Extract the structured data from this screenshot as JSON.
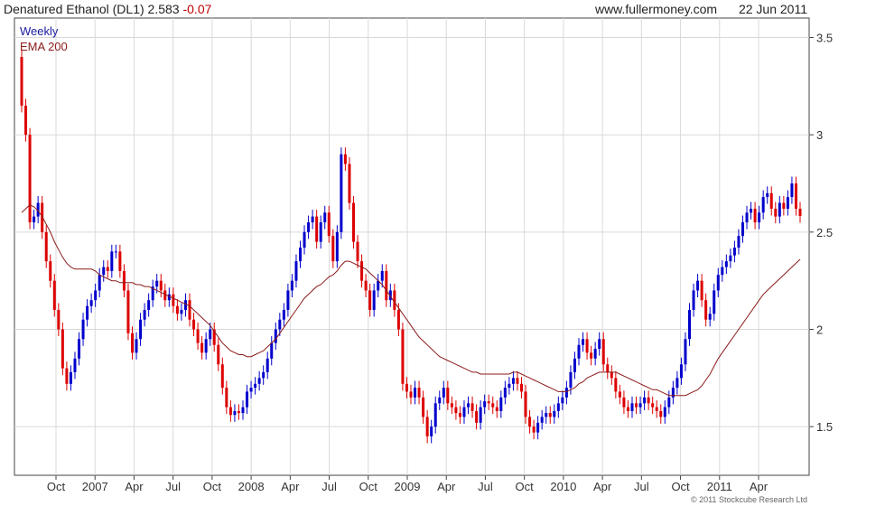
{
  "header": {
    "instrument": "Denatured Ethanol (DL1)",
    "price": "2.583",
    "change": "-0.07",
    "site": "www.fullermoney.com",
    "date": "22 Jun 2011"
  },
  "footer": {
    "copyright": "© 2011 Stockcube Research Ltd"
  },
  "colors": {
    "up": "#0000cc",
    "down": "#dd0000",
    "ema": "#8b1a1a",
    "grid": "#d9d9d9",
    "axis": "#444444"
  },
  "chart_data": {
    "type": "line",
    "legend": [
      "Weekly",
      "EMA 200"
    ],
    "legend_position": "top-left",
    "y_axis_position": "right",
    "ylim": [
      1.25,
      3.6
    ],
    "yticks": [
      1.5,
      2,
      2.5,
      3,
      3.5
    ],
    "x_labels": [
      "Oct",
      "2007",
      "Apr",
      "Jul",
      "Oct",
      "2008",
      "Apr",
      "Jul",
      "Oct",
      "2009",
      "Apr",
      "Jul",
      "Oct",
      "2010",
      "Apr",
      "Jul",
      "Oct",
      "2011",
      "Apr"
    ],
    "grid": true,
    "weekly_close": [
      3.15,
      3.0,
      2.55,
      2.58,
      2.65,
      2.5,
      2.35,
      2.25,
      2.1,
      2.0,
      1.8,
      1.72,
      1.78,
      1.85,
      1.95,
      2.05,
      2.12,
      2.15,
      2.2,
      2.28,
      2.32,
      2.3,
      2.4,
      2.4,
      2.3,
      2.2,
      1.98,
      1.88,
      1.95,
      2.05,
      2.1,
      2.15,
      2.22,
      2.25,
      2.2,
      2.15,
      2.18,
      2.12,
      2.08,
      2.1,
      2.15,
      2.05,
      2.0,
      1.93,
      1.88,
      1.95,
      2.0,
      1.92,
      1.82,
      1.7,
      1.6,
      1.56,
      1.58,
      1.57,
      1.6,
      1.68,
      1.7,
      1.72,
      1.75,
      1.78,
      1.85,
      1.93,
      2.0,
      2.05,
      2.1,
      2.2,
      2.25,
      2.35,
      2.42,
      2.5,
      2.55,
      2.58,
      2.45,
      2.55,
      2.6,
      2.48,
      2.35,
      2.5,
      2.9,
      2.85,
      2.65,
      2.45,
      2.35,
      2.25,
      2.2,
      2.1,
      2.2,
      2.25,
      2.3,
      2.15,
      2.2,
      2.1,
      2.0,
      1.72,
      1.68,
      1.65,
      1.7,
      1.65,
      1.55,
      1.45,
      1.5,
      1.62,
      1.65,
      1.7,
      1.62,
      1.6,
      1.57,
      1.55,
      1.6,
      1.62,
      1.58,
      1.52,
      1.6,
      1.63,
      1.62,
      1.6,
      1.58,
      1.65,
      1.7,
      1.72,
      1.75,
      1.72,
      1.68,
      1.55,
      1.5,
      1.47,
      1.52,
      1.55,
      1.57,
      1.55,
      1.58,
      1.62,
      1.65,
      1.7,
      1.78,
      1.85,
      1.92,
      1.95,
      1.88,
      1.85,
      1.9,
      1.95,
      1.82,
      1.78,
      1.75,
      1.68,
      1.65,
      1.6,
      1.58,
      1.62,
      1.6,
      1.62,
      1.65,
      1.62,
      1.6,
      1.58,
      1.55,
      1.6,
      1.65,
      1.7,
      1.75,
      1.82,
      1.95,
      2.1,
      2.2,
      2.25,
      2.15,
      2.05,
      2.08,
      2.2,
      2.28,
      2.32,
      2.35,
      2.38,
      2.42,
      2.48,
      2.55,
      2.6,
      2.62,
      2.55,
      2.6,
      2.68,
      2.7,
      2.62,
      2.58,
      2.65,
      2.62,
      2.68,
      2.75,
      2.62,
      2.583
    ],
    "ema_200": [
      2.6,
      2.62,
      2.64,
      2.63,
      2.61,
      2.58,
      2.54,
      2.5,
      2.45,
      2.41,
      2.37,
      2.34,
      2.32,
      2.31,
      2.31,
      2.31,
      2.31,
      2.31,
      2.3,
      2.28,
      2.27,
      2.26,
      2.25,
      2.25,
      2.24,
      2.24,
      2.24,
      2.24,
      2.23,
      2.23,
      2.22,
      2.22,
      2.21,
      2.2,
      2.19,
      2.18,
      2.17,
      2.16,
      2.15,
      2.14,
      2.13,
      2.12,
      2.1,
      2.08,
      2.06,
      2.04,
      2.02,
      1.99,
      1.96,
      1.93,
      1.91,
      1.89,
      1.88,
      1.87,
      1.87,
      1.86,
      1.86,
      1.87,
      1.88,
      1.89,
      1.91,
      1.93,
      1.95,
      1.98,
      2.01,
      2.04,
      2.07,
      2.1,
      2.13,
      2.16,
      2.18,
      2.2,
      2.22,
      2.23,
      2.25,
      2.27,
      2.28,
      2.3,
      2.33,
      2.35,
      2.35,
      2.34,
      2.33,
      2.32,
      2.31,
      2.29,
      2.27,
      2.25,
      2.23,
      2.2,
      2.17,
      2.14,
      2.11,
      2.08,
      2.05,
      2.02,
      1.99,
      1.96,
      1.94,
      1.92,
      1.9,
      1.88,
      1.86,
      1.85,
      1.84,
      1.83,
      1.82,
      1.81,
      1.8,
      1.79,
      1.78,
      1.78,
      1.77,
      1.77,
      1.77,
      1.77,
      1.77,
      1.77,
      1.77,
      1.77,
      1.78,
      1.78,
      1.77,
      1.76,
      1.75,
      1.74,
      1.73,
      1.72,
      1.71,
      1.7,
      1.69,
      1.68,
      1.68,
      1.68,
      1.69,
      1.7,
      1.72,
      1.73,
      1.75,
      1.76,
      1.77,
      1.78,
      1.78,
      1.78,
      1.78,
      1.78,
      1.77,
      1.76,
      1.75,
      1.74,
      1.73,
      1.72,
      1.71,
      1.7,
      1.69,
      1.69,
      1.68,
      1.67,
      1.66,
      1.66,
      1.66,
      1.66,
      1.66,
      1.67,
      1.68,
      1.69,
      1.71,
      1.74,
      1.77,
      1.81,
      1.85,
      1.88,
      1.91,
      1.94,
      1.97,
      2.0,
      2.03,
      2.06,
      2.09,
      2.12,
      2.15,
      2.18,
      2.2,
      2.22,
      2.24,
      2.26,
      2.28,
      2.3,
      2.32,
      2.34,
      2.36
    ]
  }
}
